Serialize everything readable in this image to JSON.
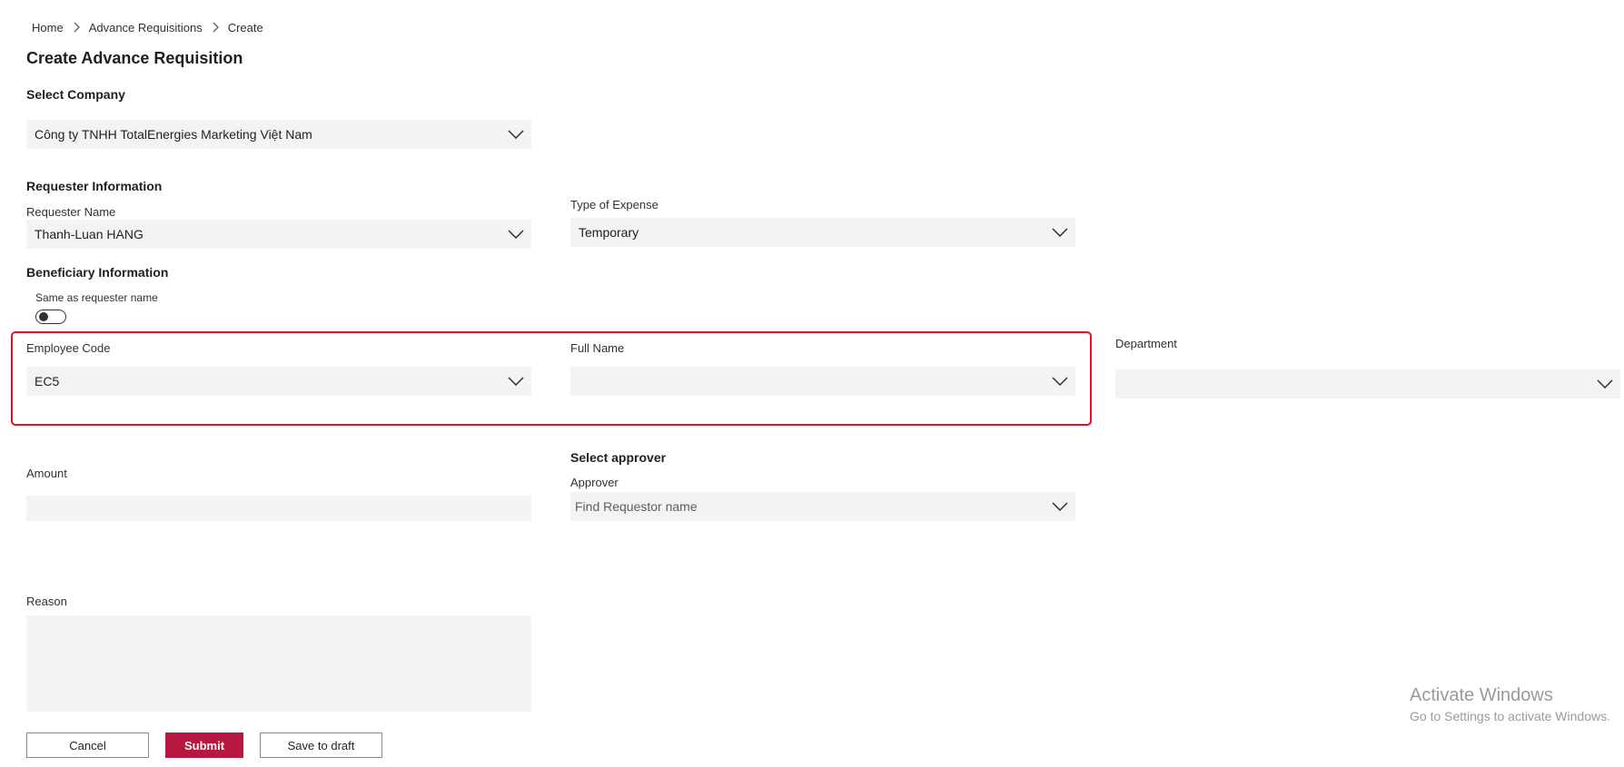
{
  "breadcrumb": {
    "items": [
      {
        "label": "Home"
      },
      {
        "label": "Advance Requisitions"
      },
      {
        "label": "Create"
      }
    ]
  },
  "page": {
    "title": "Create Advance Requisition"
  },
  "company": {
    "section_title": "Select Company",
    "value": "Công ty TNHH TotalEnergies Marketing Việt Nam"
  },
  "requester": {
    "section_title": "Requester Information",
    "name_label": "Requester Name",
    "name_value": "Thanh-Luan HANG"
  },
  "expense": {
    "type_label": "Type of Expense",
    "type_value": "Temporary"
  },
  "beneficiary": {
    "section_title": "Beneficiary Information",
    "same_as_requester_label": "Same as requester name",
    "same_as_requester_on": false,
    "employee_code_label": "Employee Code",
    "employee_code_value": "EC5",
    "full_name_label": "Full Name",
    "full_name_value": "",
    "department_label": "Department",
    "department_value": ""
  },
  "amount": {
    "label": "Amount",
    "value": ""
  },
  "approver": {
    "section_title": "Select approver",
    "label": "Approver",
    "placeholder": "Find Requestor name"
  },
  "reason": {
    "label": "Reason",
    "value": ""
  },
  "actions": {
    "cancel_label": "Cancel",
    "submit_label": "Submit",
    "save_draft_label": "Save to draft"
  },
  "watermark": {
    "title": "Activate Windows",
    "subtitle": "Go to Settings to activate Windows."
  },
  "colors": {
    "primary": "#b8173f",
    "highlight": "#e81123",
    "field_bg": "#f3f3f3"
  }
}
